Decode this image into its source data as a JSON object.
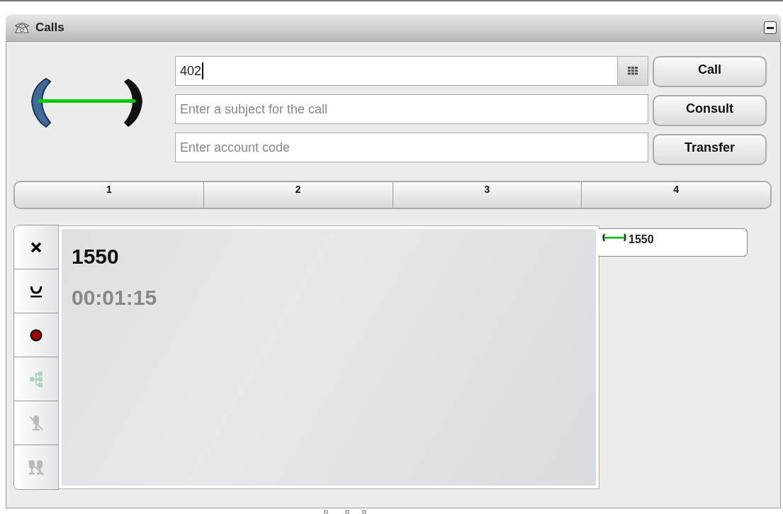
{
  "window": {
    "title": "Calls"
  },
  "dial": {
    "number": "402",
    "subject_placeholder": "Enter a subject for the call",
    "account_placeholder": "Enter account code"
  },
  "buttons": [
    "Call",
    "Consult",
    "Transfer"
  ],
  "lines": [
    {
      "label": "1",
      "selected": false
    },
    {
      "label": "2",
      "selected": false
    },
    {
      "label": "3",
      "selected": false
    },
    {
      "label": "4",
      "selected": false
    }
  ],
  "actions": [
    {
      "kind": "hangup",
      "disabled": false
    },
    {
      "kind": "hold",
      "disabled": false
    },
    {
      "kind": "record",
      "disabled": false
    },
    {
      "kind": "conference",
      "disabled": true
    },
    {
      "kind": "mute",
      "disabled": true
    },
    {
      "kind": "mute-all",
      "disabled": true
    }
  ],
  "active_call": {
    "number": "1550",
    "duration": "00:01:15"
  },
  "call_list": [
    {
      "number": "1550",
      "selected": true
    }
  ]
}
